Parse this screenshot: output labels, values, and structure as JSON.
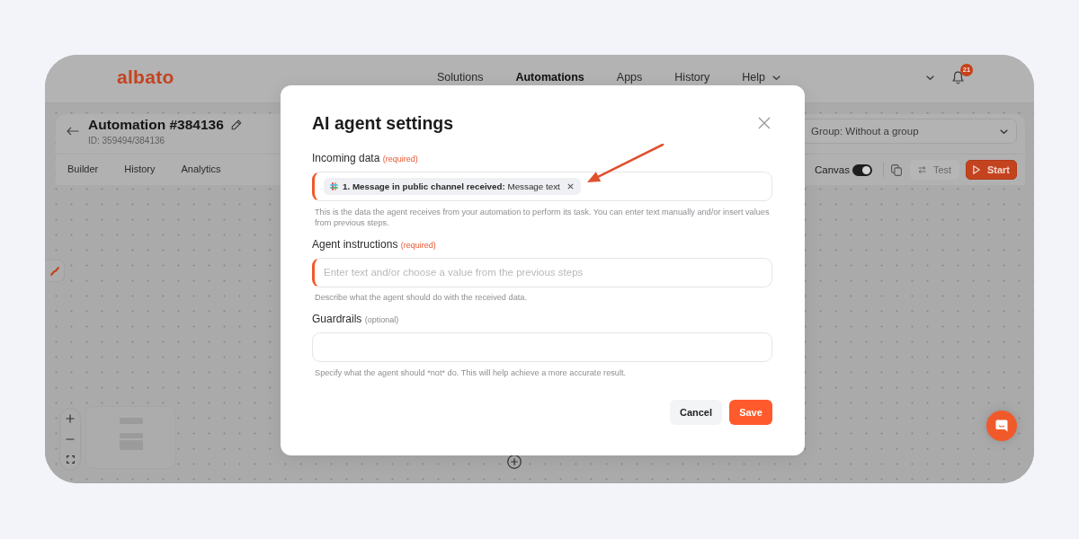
{
  "topbar": {
    "logo": "albato",
    "nav": [
      {
        "label": "Solutions",
        "selected": false,
        "has_menu": false
      },
      {
        "label": "Automations",
        "selected": true,
        "has_menu": false
      },
      {
        "label": "Apps",
        "selected": false,
        "has_menu": false
      },
      {
        "label": "History",
        "selected": false,
        "has_menu": false
      },
      {
        "label": "Help",
        "selected": false,
        "has_menu": true
      }
    ],
    "notifications": "21"
  },
  "automation": {
    "title": "Automation #384136",
    "id": "ID: 359494/384136",
    "group": "Group: Without a group",
    "tabs": [
      {
        "label": "Builder",
        "selected": false
      },
      {
        "label": "History",
        "selected": false
      },
      {
        "label": "Analytics",
        "selected": false
      }
    ],
    "canvas_toggle": {
      "label": "Canvas",
      "on": true
    },
    "buttons": [
      {
        "label": "Test",
        "kind": "secondary"
      },
      {
        "label": "Start",
        "kind": "primary"
      }
    ]
  },
  "dialog": {
    "title": "AI agent settings",
    "fields": [
      {
        "label": "Incoming data",
        "note": "(required)",
        "required": true,
        "chips": [
          {
            "step": "1. Message in public channel received:",
            "value": "Message text"
          }
        ],
        "hint": "This is the data the agent receives from your automation to perform its task. You can enter text manually and/or insert values from previous steps."
      },
      {
        "label": "Agent instructions",
        "note": "(required)",
        "required": true,
        "placeholder": "Enter text and/or choose a value from the previous steps",
        "hint": "Describe what the agent should do with the received data."
      },
      {
        "label": "Guardrails",
        "note": "(optional)",
        "required": false,
        "hint": "Specify what the agent should *not* do. This will help achieve a more accurate result."
      }
    ],
    "buttons": [
      {
        "label": "Cancel",
        "kind": "secondary"
      },
      {
        "label": "Save",
        "kind": "primary"
      }
    ]
  }
}
